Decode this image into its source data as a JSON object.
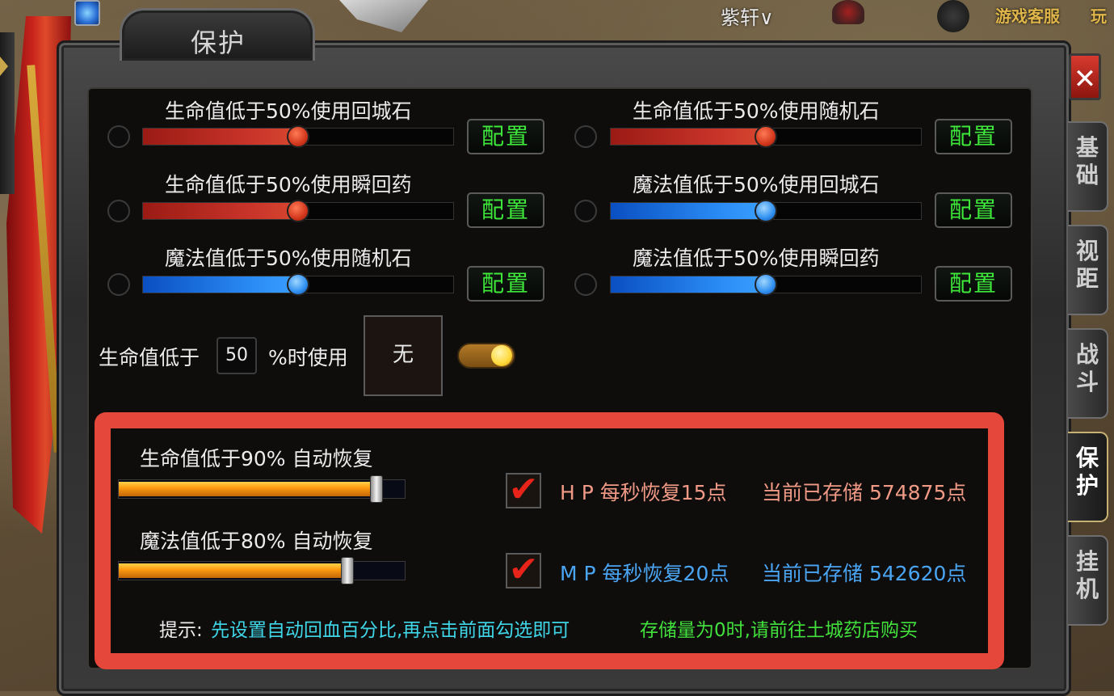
{
  "window": {
    "title": "保护",
    "close_symbol": "✕"
  },
  "topbar": {
    "player_name": "紫轩∨",
    "service": "游戏客服",
    "play_cut": "玩"
  },
  "side_tabs": [
    {
      "label": "基础",
      "active": false
    },
    {
      "label": "视距",
      "active": false
    },
    {
      "label": "战斗",
      "active": false
    },
    {
      "label": "保护",
      "active": true
    },
    {
      "label": "挂机",
      "active": false
    }
  ],
  "protect_rows": [
    {
      "label": "生命值低于50%使用回城石",
      "percent": 50,
      "color": "red",
      "button": "配置"
    },
    {
      "label": "生命值低于50%使用随机石",
      "percent": 50,
      "color": "red",
      "button": "配置"
    },
    {
      "label": "生命值低于50%使用瞬回药",
      "percent": 50,
      "color": "red",
      "button": "配置"
    },
    {
      "label": "魔法值低于50%使用回城石",
      "percent": 50,
      "color": "blue",
      "button": "配置"
    },
    {
      "label": "魔法值低于50%使用随机石",
      "percent": 50,
      "color": "blue",
      "button": "配置"
    },
    {
      "label": "魔法值低于50%使用瞬回药",
      "percent": 50,
      "color": "blue",
      "button": "配置"
    }
  ],
  "custom_use": {
    "label_before": "生命值低于",
    "value": "50",
    "label_after": "%时使用",
    "item": "无",
    "toggle_on": true
  },
  "auto_recover": {
    "hp": {
      "label": "生命值低于90% 自动恢复",
      "percent": 90,
      "checked": true,
      "rate": "H P  每秒恢复15点",
      "stored": "当前已存储 574875点"
    },
    "mp": {
      "label": "魔法值低于80% 自动恢复",
      "percent": 80,
      "checked": true,
      "rate": "M P  每秒恢复20点",
      "stored": "当前已存储 542620点"
    }
  },
  "tip": {
    "prefix": "提示:",
    "instruction": "先设置自动回血百分比,再点击前面勾选即可",
    "warning": "存储量为0时,请前往土城药店购买"
  },
  "colors": {
    "accent_red": "#e5473b",
    "config_green": "#3ee83a",
    "hp_text": "#f09a86",
    "mp_text": "#4aa6f5",
    "tip_cyan": "#3fd6e8",
    "tip_green": "#42e03c"
  },
  "icons": {
    "close": "close-icon",
    "check": "checkmark-icon"
  }
}
